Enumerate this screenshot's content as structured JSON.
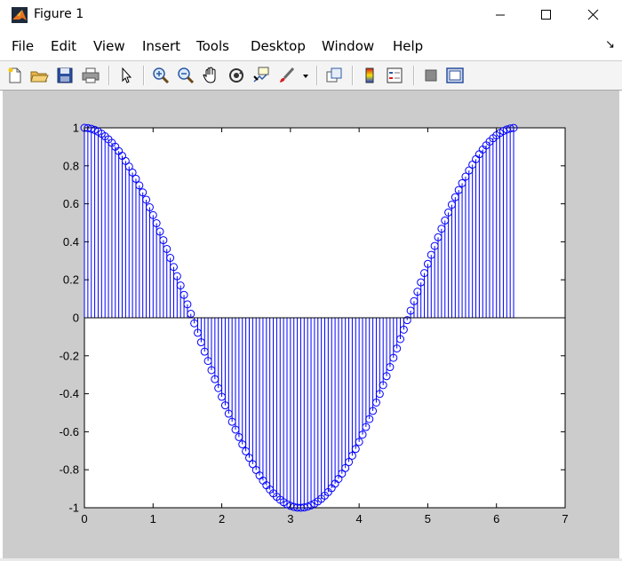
{
  "window": {
    "title": "Figure 1"
  },
  "menu": [
    "File",
    "Edit",
    "View",
    "Insert",
    "Tools",
    "Desktop",
    "Window",
    "Help"
  ],
  "menu_overflow": "↘",
  "toolbar": [
    "new-figure-icon",
    "open-file-icon",
    "save-icon",
    "print-icon",
    "pointer-icon",
    "zoom-in-icon",
    "zoom-out-icon",
    "pan-hand-icon",
    "rotate-3d-icon",
    "data-cursor-icon",
    "brush-icon",
    "brush-dropdown-icon",
    "link-plot-icon",
    "colorbar-icon",
    "legend-icon",
    "hide-plot-tools-icon",
    "show-plot-tools-icon"
  ],
  "colors": {
    "stem": "#0000ff",
    "figure_bg": "#cccccc",
    "axes_bg": "#ffffff"
  },
  "chart_data": {
    "type": "stem",
    "function": "cos",
    "x_start": 0,
    "x_step": 0.05,
    "n_points": 126,
    "marker": "circle",
    "baseline": 0,
    "xlim": [
      0,
      7
    ],
    "ylim": [
      -1,
      1
    ],
    "xticks": [
      "0",
      "1",
      "2",
      "3",
      "4",
      "5",
      "6",
      "7"
    ],
    "yticks": [
      "-1",
      "-0.8",
      "-0.6",
      "-0.4",
      "-0.2",
      "0",
      "0.2",
      "0.4",
      "0.6",
      "0.8",
      "1"
    ],
    "grid": false
  }
}
